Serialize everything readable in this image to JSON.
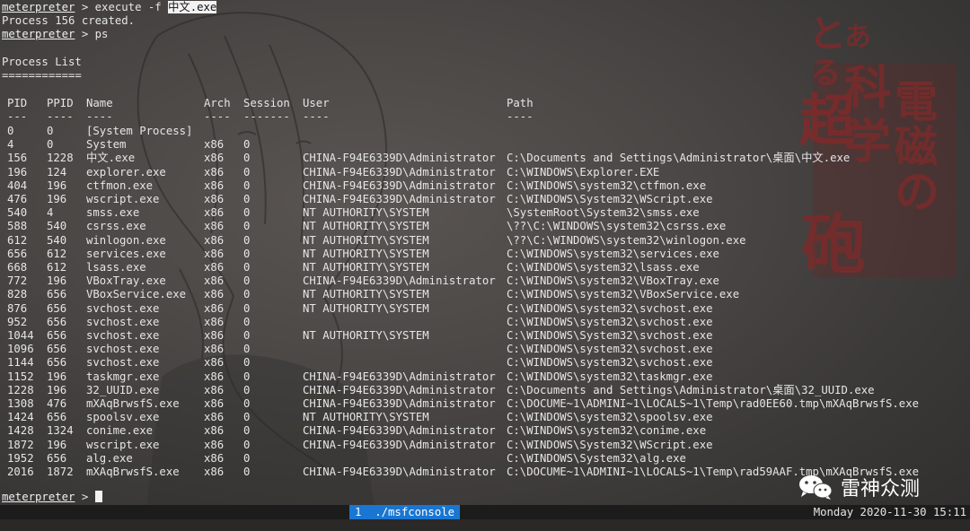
{
  "session": {
    "prompt": "meterpreter",
    "separator": " > ",
    "cmd1": "execute -f ",
    "cmd1_highlight": "中文.exe",
    "out1": "Process 156 created.",
    "cmd2": "ps"
  },
  "process_list": {
    "title": "Process List",
    "underline": "============",
    "headers": [
      "PID",
      "PPID",
      "Name",
      "Arch",
      "Session",
      "User",
      "Path"
    ],
    "header_rules": [
      "---",
      "----",
      "----",
      "----",
      "-------",
      "----",
      "----"
    ],
    "rows": [
      [
        "0",
        "0",
        "[System Process]",
        "",
        "",
        "",
        ""
      ],
      [
        "4",
        "0",
        "System",
        "x86",
        "0",
        "",
        ""
      ],
      [
        "156",
        "1228",
        "中文.exe",
        "x86",
        "0",
        "CHINA-F94E6339D\\Administrator",
        "C:\\Documents and Settings\\Administrator\\桌面\\中文.exe"
      ],
      [
        "196",
        "124",
        "explorer.exe",
        "x86",
        "0",
        "CHINA-F94E6339D\\Administrator",
        "C:\\WINDOWS\\Explorer.EXE"
      ],
      [
        "404",
        "196",
        "ctfmon.exe",
        "x86",
        "0",
        "CHINA-F94E6339D\\Administrator",
        "C:\\WINDOWS\\system32\\ctfmon.exe"
      ],
      [
        "476",
        "196",
        "wscript.exe",
        "x86",
        "0",
        "CHINA-F94E6339D\\Administrator",
        "C:\\WINDOWS\\System32\\WScript.exe"
      ],
      [
        "540",
        "4",
        "smss.exe",
        "x86",
        "0",
        "NT AUTHORITY\\SYSTEM",
        "\\SystemRoot\\System32\\smss.exe"
      ],
      [
        "588",
        "540",
        "csrss.exe",
        "x86",
        "0",
        "NT AUTHORITY\\SYSTEM",
        "\\??\\C:\\WINDOWS\\system32\\csrss.exe"
      ],
      [
        "612",
        "540",
        "winlogon.exe",
        "x86",
        "0",
        "NT AUTHORITY\\SYSTEM",
        "\\??\\C:\\WINDOWS\\system32\\winlogon.exe"
      ],
      [
        "656",
        "612",
        "services.exe",
        "x86",
        "0",
        "NT AUTHORITY\\SYSTEM",
        "C:\\WINDOWS\\system32\\services.exe"
      ],
      [
        "668",
        "612",
        "lsass.exe",
        "x86",
        "0",
        "NT AUTHORITY\\SYSTEM",
        "C:\\WINDOWS\\system32\\lsass.exe"
      ],
      [
        "772",
        "196",
        "VBoxTray.exe",
        "x86",
        "0",
        "CHINA-F94E6339D\\Administrator",
        "C:\\WINDOWS\\system32\\VBoxTray.exe"
      ],
      [
        "828",
        "656",
        "VBoxService.exe",
        "x86",
        "0",
        "NT AUTHORITY\\SYSTEM",
        "C:\\WINDOWS\\system32\\VBoxService.exe"
      ],
      [
        "876",
        "656",
        "svchost.exe",
        "x86",
        "0",
        "NT AUTHORITY\\SYSTEM",
        "C:\\WINDOWS\\system32\\svchost.exe"
      ],
      [
        "952",
        "656",
        "svchost.exe",
        "x86",
        "0",
        "",
        "C:\\WINDOWS\\system32\\svchost.exe"
      ],
      [
        "1044",
        "656",
        "svchost.exe",
        "x86",
        "0",
        "NT AUTHORITY\\SYSTEM",
        "C:\\WINDOWS\\System32\\svchost.exe"
      ],
      [
        "1096",
        "656",
        "svchost.exe",
        "x86",
        "0",
        "",
        "C:\\WINDOWS\\system32\\svchost.exe"
      ],
      [
        "1144",
        "656",
        "svchost.exe",
        "x86",
        "0",
        "",
        "C:\\WINDOWS\\system32\\svchost.exe"
      ],
      [
        "1152",
        "196",
        "taskmgr.exe",
        "x86",
        "0",
        "CHINA-F94E6339D\\Administrator",
        "C:\\WINDOWS\\system32\\taskmgr.exe"
      ],
      [
        "1228",
        "196",
        "32_UUID.exe",
        "x86",
        "0",
        "CHINA-F94E6339D\\Administrator",
        "C:\\Documents and Settings\\Administrator\\桌面\\32_UUID.exe"
      ],
      [
        "1308",
        "476",
        "mXAqBrwsfS.exe",
        "x86",
        "0",
        "CHINA-F94E6339D\\Administrator",
        "C:\\DOCUME~1\\ADMINI~1\\LOCALS~1\\Temp\\rad0EE60.tmp\\mXAqBrwsfS.exe"
      ],
      [
        "1424",
        "656",
        "spoolsv.exe",
        "x86",
        "0",
        "NT AUTHORITY\\SYSTEM",
        "C:\\WINDOWS\\system32\\spoolsv.exe"
      ],
      [
        "1428",
        "1324",
        "conime.exe",
        "x86",
        "0",
        "CHINA-F94E6339D\\Administrator",
        "C:\\WINDOWS\\system32\\conime.exe"
      ],
      [
        "1872",
        "196",
        "wscript.exe",
        "x86",
        "0",
        "CHINA-F94E6339D\\Administrator",
        "C:\\WINDOWS\\System32\\WScript.exe"
      ],
      [
        "1952",
        "656",
        "alg.exe",
        "x86",
        "0",
        "",
        "C:\\WINDOWS\\System32\\alg.exe"
      ],
      [
        "2016",
        "1872",
        "mXAqBrwsfS.exe",
        "x86",
        "0",
        "CHINA-F94E6339D\\Administrator",
        "C:\\DOCUME~1\\ADMINI~1\\LOCALS~1\\Temp\\rad59AAF.tmp\\mXAqBrwsfS.exe"
      ]
    ]
  },
  "statusbar": {
    "tab_label": "1  ./msfconsole",
    "clock": "Monday 2020-11-30 15:11"
  },
  "wallpaper": {
    "title_glyphs": [
      "と",
      "あ",
      "る",
      "科",
      "学",
      "の",
      "超",
      "電",
      "磁",
      "砲"
    ]
  },
  "brand": {
    "name": "雷神众测",
    "icon": "wechat-icon"
  },
  "colors": {
    "tab_active": "#1976d2",
    "statusbar_bg": "#1c1c1c",
    "text": "#e6e6e6",
    "wallpaper_title": "#7a2b2b"
  }
}
